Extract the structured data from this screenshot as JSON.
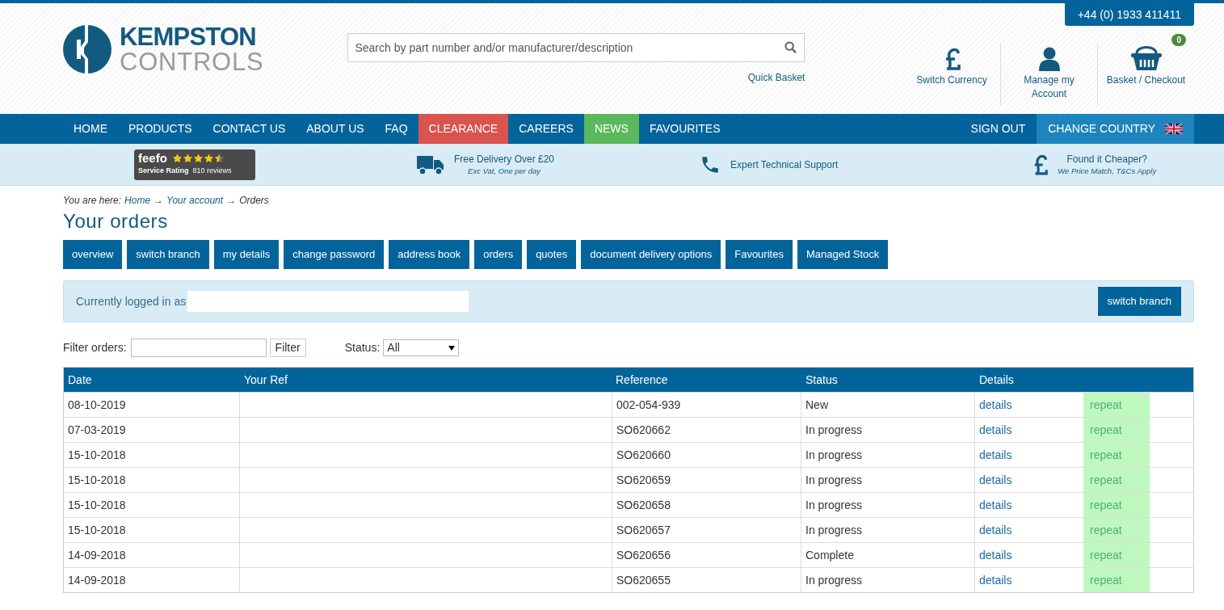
{
  "header": {
    "logo": {
      "line_1": "KEMPSTON",
      "line_2": "CONTROLS"
    },
    "phone": "+44 (0) 1933 411411",
    "search": {
      "placeholder": "Search by part number and/or manufacturer/description"
    },
    "quick_basket": "Quick Basket",
    "actions": [
      {
        "kind": "currency",
        "label": "Switch Currency"
      },
      {
        "kind": "account",
        "label": "Manage my Account"
      },
      {
        "kind": "basket",
        "label": "Basket / Checkout",
        "badge": "0"
      }
    ]
  },
  "nav": {
    "items": [
      {
        "label": "HOME"
      },
      {
        "label": "PRODUCTS"
      },
      {
        "label": "CONTACT US"
      },
      {
        "label": "ABOUT US"
      },
      {
        "label": "FAQ"
      },
      {
        "label": "CLEARANCE",
        "color": "#d9534f"
      },
      {
        "label": "CAREERS"
      },
      {
        "label": "NEWS",
        "color": "#5cb85c"
      },
      {
        "label": "FAVOURITES"
      }
    ],
    "right": [
      {
        "kind": "link",
        "label": "SIGN OUT"
      },
      {
        "kind": "country",
        "label": "CHANGE COUNTRY"
      }
    ]
  },
  "benefits": {
    "feefo": {
      "brand": "feefo",
      "caption": "Service Rating",
      "reviews": "810 reviews",
      "stars": 4.5
    },
    "items": [
      {
        "kind": "truck",
        "title": "Free Delivery Over £20",
        "subtitle": "Exc Vat, One per day"
      },
      {
        "kind": "phone",
        "title": "Expert Technical Support"
      },
      {
        "kind": "pound",
        "title": "Found it Cheaper?",
        "subtitle": "We Price Match, T&Cs Apply"
      }
    ]
  },
  "breadcrumb": {
    "prefix": "You are here:",
    "links": [
      "Home",
      "Your account"
    ],
    "separator": "→",
    "current": "Orders"
  },
  "title": "Your orders",
  "account_tabs": [
    "overview",
    "switch branch",
    "my details",
    "change password",
    "address book",
    "orders",
    "quotes",
    "document delivery options",
    "Favourites",
    "Managed Stock"
  ],
  "login_box": {
    "text": "Currently logged in as",
    "button": "switch branch"
  },
  "filter": {
    "label": "Filter orders:",
    "button": "Filter",
    "status_label": "Status:",
    "status_value": "All"
  },
  "table": {
    "columns": [
      "Date",
      "Your Ref",
      "Reference",
      "Status",
      "Details"
    ],
    "rows": [
      {
        "date": "08-10-2019",
        "reference": "002-054-939",
        "status": "New",
        "details": "details",
        "repeat": "repeat"
      },
      {
        "date": "07-03-2019",
        "reference": "SO620662",
        "status": "In progress",
        "details": "details",
        "repeat": "repeat"
      },
      {
        "date": "15-10-2018",
        "reference": "SO620660",
        "status": "In progress",
        "details": "details",
        "repeat": "repeat"
      },
      {
        "date": "15-10-2018",
        "reference": "SO620659",
        "status": "In progress",
        "details": "details",
        "repeat": "repeat"
      },
      {
        "date": "15-10-2018",
        "reference": "SO620658",
        "status": "In progress",
        "details": "details",
        "repeat": "repeat"
      },
      {
        "date": "15-10-2018",
        "reference": "SO620657",
        "status": "In progress",
        "details": "details",
        "repeat": "repeat"
      },
      {
        "date": "14-09-2018",
        "reference": "SO620656",
        "status": "Complete",
        "details": "details",
        "repeat": "repeat"
      },
      {
        "date": "14-09-2018",
        "reference": "SO620655",
        "status": "In progress",
        "details": "details",
        "repeat": "repeat"
      }
    ]
  }
}
